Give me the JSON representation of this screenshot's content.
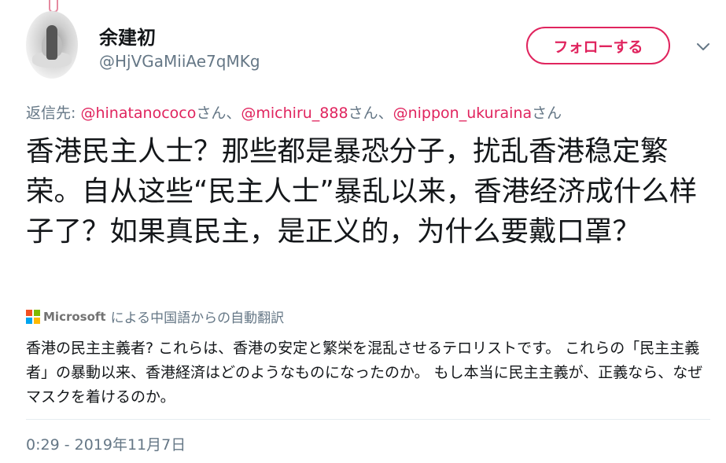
{
  "user": {
    "display_name": "余建初",
    "handle": "@HjVGaMiiAe7qMKg"
  },
  "follow_button": {
    "label": "フォローする"
  },
  "reply": {
    "prefix": "返信先: ",
    "mentions": [
      {
        "handle": "@hinatanococo",
        "suffix": "さん、"
      },
      {
        "handle": "@michiru_888",
        "suffix": "さん、"
      },
      {
        "handle": "@nippon_ukuraina",
        "suffix": "さん"
      }
    ]
  },
  "tweet": {
    "text": "香港民主人士？那些都是暴恐分子，扰乱香港稳定繁荣。自从这些“民主人士”暴乱以来，香港经济成什么样子了？如果真民主，是正义的，为什么要戴口罩？"
  },
  "translation": {
    "brand": "Microsoft",
    "label": "による中国語からの自動翻訳",
    "text": "香港の民主主義者? これらは、香港の安定と繁栄を混乱させるテロリストです。 これらの「民主主義者」の暴動以来、香港経済はどのようなものになったのか。 もし本当に民主主義が、正義なら、なぜマスクを着けるのか。"
  },
  "timestamp": "0:29 - 2019年11月7日",
  "icons": {
    "more": "chevron-down-icon",
    "brand": "microsoft-logo-icon"
  },
  "colors": {
    "accent": "#e0245e",
    "secondary_text": "#657786",
    "ms_red": "#f25022",
    "ms_green": "#7fba00",
    "ms_blue": "#00a4ef",
    "ms_yellow": "#ffb900"
  }
}
